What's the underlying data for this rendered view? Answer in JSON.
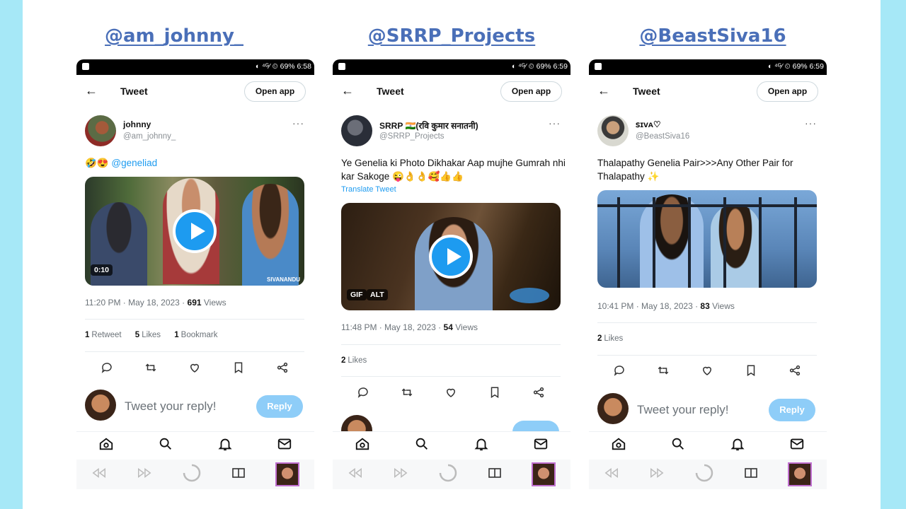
{
  "columns": [
    {
      "handle": "@am_johnny_",
      "status_right": "◐ ⁴ᴳ⁄ ⏲ 69% 6:58",
      "nav": {
        "back_icon": "back-arrow-icon",
        "title": "Tweet",
        "open_app": "Open app"
      },
      "author": {
        "name": "johnny",
        "handle": "@am_johnny_"
      },
      "more": "···",
      "text_emoji": "🤣😍",
      "text_mention": "@geneliad",
      "media": {
        "duration": "0:10",
        "watermark": "SIVANANDU"
      },
      "meta": {
        "time": "11:20 PM · May 18, 2023 · ",
        "views_count": "691",
        "views_label": " Views"
      },
      "stats": [
        {
          "count": "1",
          "label": "Retweet"
        },
        {
          "count": "5",
          "label": "Likes"
        },
        {
          "count": "1",
          "label": "Bookmark"
        }
      ],
      "reply": {
        "placeholder": "Tweet your reply!",
        "button": "Reply"
      }
    },
    {
      "handle": "@SRRP_Projects",
      "status_right": "◐ ⁴ᴳ⁄ ⏲ 69% 6:59",
      "nav": {
        "back_icon": "back-arrow-icon",
        "title": "Tweet",
        "open_app": "Open app"
      },
      "author": {
        "name": "SRRP 🇮🇳(रवि कुमार सनातनी)",
        "handle": "@SRRP_Projects"
      },
      "more": "···",
      "text": "Ye Genelia ki Photo Dikhakar Aap mujhe Gumrah nhi kar Sakoge 😜👌👌🥰👍👍",
      "translate": "Translate Tweet",
      "media": {
        "badge_gif": "GIF",
        "badge_alt": "ALT"
      },
      "meta": {
        "time": "11:48 PM · May 18, 2023 · ",
        "views_count": "54",
        "views_label": " Views"
      },
      "stats": [
        {
          "count": "2",
          "label": "Likes"
        }
      ]
    },
    {
      "handle": "@BeastSiva16",
      "status_right": "◐ ⁴ᴳ⁄ ⏲ 69% 6:59",
      "nav": {
        "back_icon": "back-arrow-icon",
        "title": "Tweet",
        "open_app": "Open app"
      },
      "author": {
        "name": "ꜱɪᴠᴀ♡",
        "handle": "@BeastSiva16"
      },
      "more": "···",
      "text": "Thalapathy Genelia Pair>>>Any Other Pair for Thalapathy ✨",
      "meta": {
        "time": "10:41 PM · May 18, 2023 · ",
        "views_count": "83",
        "views_label": " Views"
      },
      "stats": [
        {
          "count": "2",
          "label": "Likes"
        }
      ],
      "reply": {
        "placeholder": "Tweet your reply!",
        "button": "Reply"
      }
    }
  ],
  "icons": {
    "actions": [
      "reply-icon",
      "retweet-icon",
      "like-icon",
      "bookmark-icon",
      "share-icon"
    ],
    "tabs": [
      "home-icon",
      "search-icon",
      "notifications-icon",
      "messages-icon"
    ],
    "system": [
      "rewind-icon",
      "fast-forward-icon",
      "loading-icon",
      "app-switcher-icon",
      "profile-thumbnail"
    ]
  },
  "colors": {
    "background": "#a6e8f7",
    "accent": "#1d9bf0",
    "handle_heading": "#4a6fb8",
    "reply_button": "#8ecdf8"
  }
}
